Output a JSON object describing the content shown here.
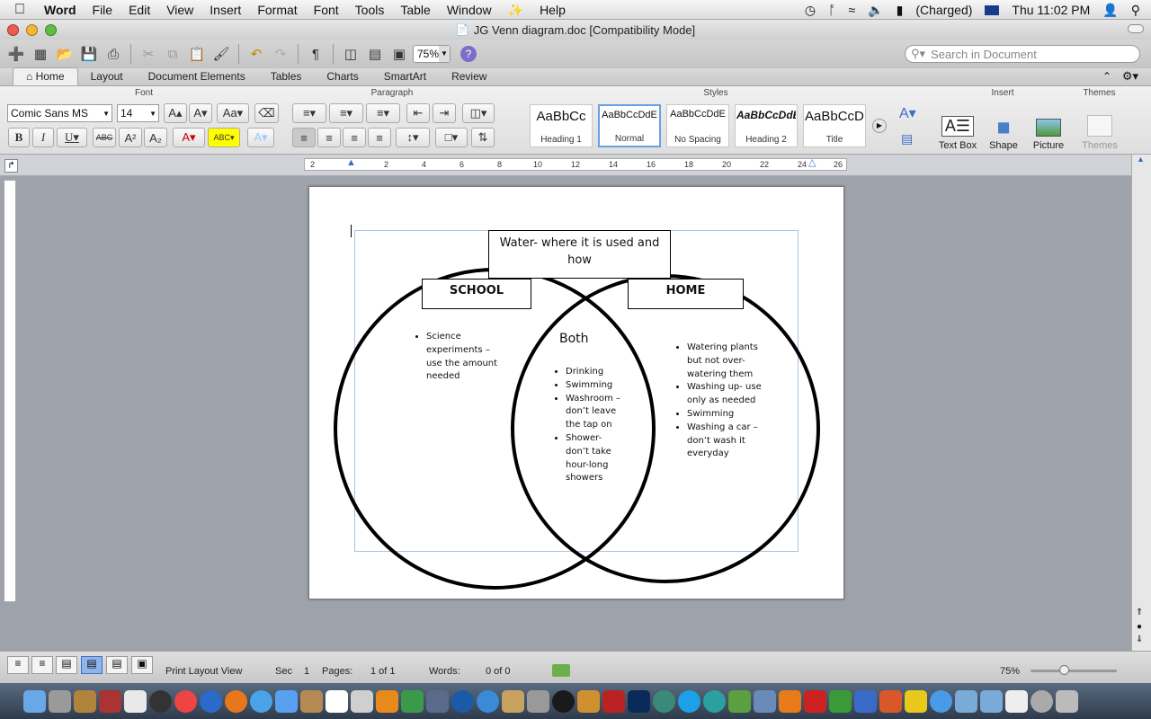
{
  "menubar": {
    "app": "Word",
    "items": [
      "File",
      "Edit",
      "View",
      "Insert",
      "Format",
      "Font",
      "Tools",
      "Table",
      "Window",
      "Help"
    ],
    "battery": "(Charged)",
    "clock": "Thu 11:02 PM"
  },
  "window": {
    "title": "JG Venn diagram.doc [Compatibility Mode]"
  },
  "toolbar": {
    "zoom": "75%",
    "search_placeholder": "Search in Document"
  },
  "ribbon": {
    "tabs": [
      "Home",
      "Layout",
      "Document Elements",
      "Tables",
      "Charts",
      "SmartArt",
      "Review"
    ],
    "active_tab": "Home",
    "groups": {
      "font": "Font",
      "paragraph": "Paragraph",
      "styles": "Styles",
      "insert": "Insert",
      "themes": "Themes"
    },
    "font_name": "Comic Sans MS",
    "font_size": "14",
    "styles": [
      {
        "sample": "AaBbCc",
        "label": "Heading 1"
      },
      {
        "sample": "AaBbCcDdE",
        "label": "Normal"
      },
      {
        "sample": "AaBbCcDdE",
        "label": "No Spacing"
      },
      {
        "sample": "AaBbCcDdE",
        "label": "Heading 2"
      },
      {
        "sample": "AaBbCcDd",
        "label": "Title"
      }
    ],
    "insert": {
      "text_box": "Text Box",
      "shape": "Shape",
      "picture": "Picture"
    },
    "themes_label": "Themes"
  },
  "ruler": {
    "h_ticks": [
      "2",
      "2",
      "4",
      "6",
      "8",
      "10",
      "12",
      "14",
      "16",
      "18",
      "20",
      "22",
      "24",
      "26"
    ]
  },
  "venn": {
    "title": "Water- where it is used and how",
    "left_label": "SCHOOL",
    "right_label": "HOME",
    "middle_label": "Both",
    "left_items": [
      "Science experiments – use the amount needed"
    ],
    "middle_items": [
      "Drinking",
      "Swimming",
      "Washroom – don’t leave the tap on",
      "Shower- don’t take hour-long showers"
    ],
    "right_items": [
      "Watering plants but not over-watering them",
      "Washing up- use only as needed",
      "Swimming",
      "Washing a car – don’t wash it everyday"
    ]
  },
  "status": {
    "view": "Print Layout View",
    "sec_label": "Sec",
    "sec": "1",
    "pages_label": "Pages:",
    "pages": "1 of 1",
    "words_label": "Words:",
    "words": "0 of 0",
    "zoom": "75%"
  }
}
